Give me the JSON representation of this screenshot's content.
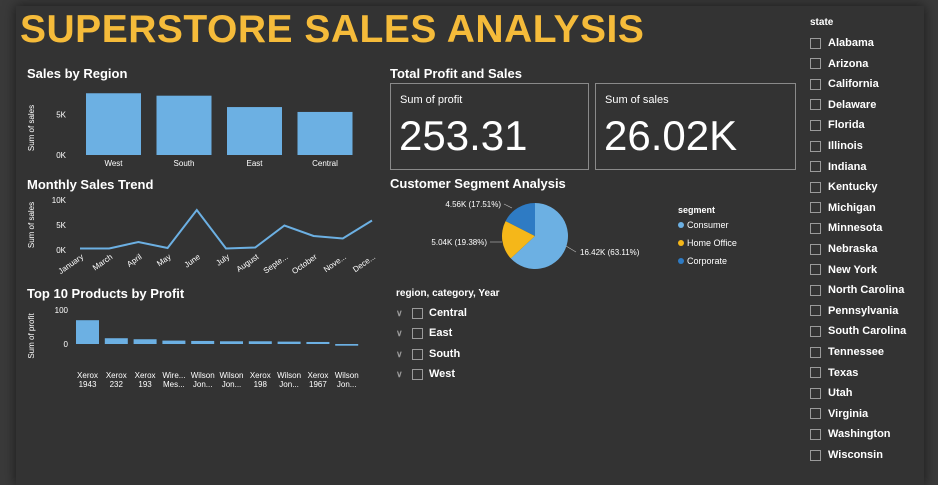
{
  "title": "SUPERSTORE SALES ANALYSIS",
  "region_chart": {
    "title": "Sales by Region",
    "chart_data": {
      "type": "bar",
      "categories": [
        "West",
        "South",
        "East",
        "Central"
      ],
      "values": [
        7.6,
        7.3,
        5.9,
        5.3
      ],
      "ylabel": "Sum of sales",
      "yticks": [
        "0K",
        "5K"
      ],
      "ylim": [
        0,
        8
      ]
    }
  },
  "trend_chart": {
    "title": "Monthly Sales Trend",
    "chart_data": {
      "type": "line",
      "categories": [
        "January",
        "March",
        "April",
        "May",
        "June",
        "July",
        "August",
        "Septe...",
        "October",
        "Nove...",
        "Dece..."
      ],
      "values": [
        0.3,
        0.3,
        1.6,
        0.4,
        8.0,
        0.3,
        0.5,
        4.9,
        2.8,
        2.3,
        5.9
      ],
      "ylabel": "Sum of sales",
      "yticks": [
        "0K",
        "5K",
        "10K"
      ],
      "ylim": [
        0,
        10
      ]
    }
  },
  "products_chart": {
    "title": "Top 10 Products by Profit",
    "chart_data": {
      "type": "bar",
      "categories": [
        [
          "Xerox",
          "1943"
        ],
        [
          "Xerox",
          "232"
        ],
        [
          "Xerox",
          "193"
        ],
        [
          "Wire...",
          "Mes..."
        ],
        [
          "Wilson",
          "Jon..."
        ],
        [
          "Wilson",
          "Jon..."
        ],
        [
          "Xerox",
          "198"
        ],
        [
          "Wilson",
          "Jon..."
        ],
        [
          "Xerox",
          "1967"
        ],
        [
          "Wilson",
          "Jon..."
        ]
      ],
      "values": [
        70,
        17,
        14,
        10,
        9,
        8,
        8,
        7,
        6,
        -5
      ],
      "ylabel": "Sum of profit",
      "yticks": [
        "0",
        "100"
      ],
      "ylim": [
        -10,
        100
      ]
    }
  },
  "kpi": {
    "title": "Total Profit and Sales",
    "profit_label": "Sum of profit",
    "profit_value": "253.31",
    "sales_label": "Sum of sales",
    "sales_value": "26.02K"
  },
  "segment_chart": {
    "title": "Customer Segment Analysis",
    "legend_title": "segment",
    "chart_data": {
      "type": "pie",
      "labels": [
        "Consumer",
        "Home Office",
        "Corporate"
      ],
      "values": [
        16.42,
        5.04,
        4.56
      ],
      "data_labels": [
        "16.42K (63.11%)",
        "5.04K (19.38%)",
        "4.56K (17.51%)"
      ],
      "colors": [
        "#6cb0e3",
        "#f5b719",
        "#2e7bc4"
      ]
    }
  },
  "tree_filter": {
    "title": "region, category, Year",
    "items": [
      "Central",
      "East",
      "South",
      "West"
    ]
  },
  "state_filter": {
    "title": "state",
    "items": [
      "Alabama",
      "Arizona",
      "California",
      "Delaware",
      "Florida",
      "Illinois",
      "Indiana",
      "Kentucky",
      "Michigan",
      "Minnesota",
      "Nebraska",
      "New York",
      "North Carolina",
      "Pennsylvania",
      "South Carolina",
      "Tennessee",
      "Texas",
      "Utah",
      "Virginia",
      "Washington",
      "Wisconsin"
    ]
  },
  "colors": {
    "accent": "#f5bb3a",
    "bar": "#6cb0e3",
    "line": "#6cb0e3",
    "background": "#333333"
  }
}
